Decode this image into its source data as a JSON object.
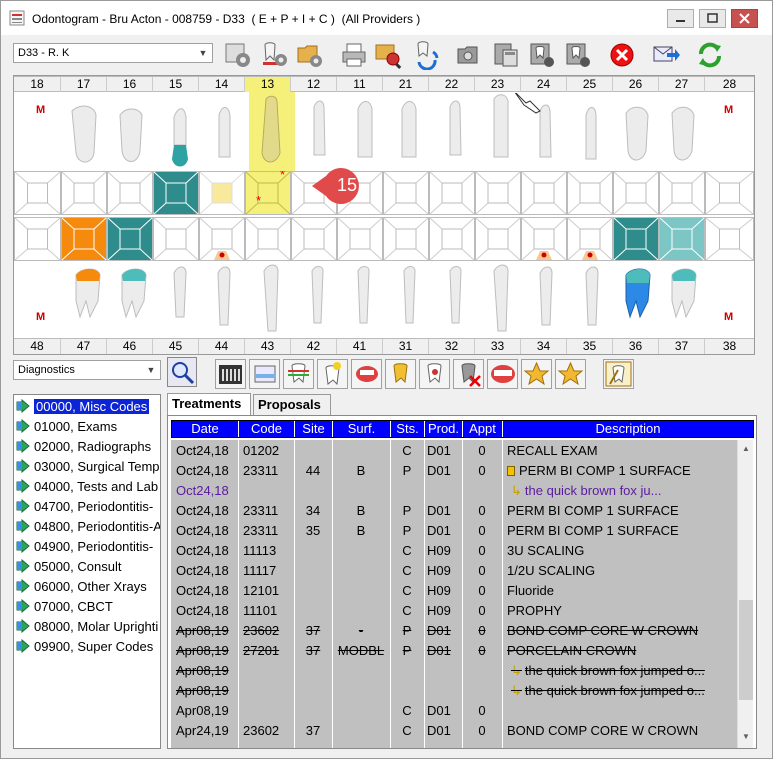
{
  "window": {
    "title": "Odontogram - Bru Acton - 008759 - D33  ( E + P + I + C )  (All Providers )"
  },
  "toolbar": {
    "provider_combo": "D33 - R. K",
    "icons": [
      "settings-icon",
      "tooth-settings-icon",
      "folder-settings-icon",
      "print-icon",
      "search-plan-icon",
      "refresh-tooth-icon",
      "camera-icon",
      "calculator-icon",
      "tooth-info-icon",
      "tooth-check-icon",
      "cancel-icon",
      "send-icon",
      "sync-icon"
    ]
  },
  "chart": {
    "upper_numbers": [
      "18",
      "17",
      "16",
      "15",
      "14",
      "13",
      "12",
      "11",
      "21",
      "22",
      "23",
      "24",
      "25",
      "26",
      "27",
      "28"
    ],
    "lower_numbers": [
      "48",
      "47",
      "46",
      "45",
      "44",
      "43",
      "42",
      "41",
      "31",
      "32",
      "33",
      "34",
      "35",
      "36",
      "37",
      "38"
    ],
    "missing_marks": [
      "M",
      "M",
      "M",
      "M"
    ],
    "callout_value": "15",
    "colors": {
      "teal": "#2e8c8c",
      "light_teal": "#7cc6c6",
      "orange": "#f58a0c",
      "light_yellow": "#f8e99c",
      "highlight": "#f5f07a",
      "peach": "#f8c890"
    }
  },
  "category_combo": "Diagnostics",
  "tree": [
    {
      "label": "00000, Misc Codes",
      "selected": true
    },
    {
      "label": "01000, Exams"
    },
    {
      "label": "02000, Radiographs"
    },
    {
      "label": "03000, Surgical Temp"
    },
    {
      "label": "04000, Tests and Lab"
    },
    {
      "label": "04700, Periodontitis-"
    },
    {
      "label": "04800, Periodontitis-A"
    },
    {
      "label": "04900, Periodontitis-"
    },
    {
      "label": "05000, Consult"
    },
    {
      "label": "06000, Other Xrays"
    },
    {
      "label": "07000, CBCT"
    },
    {
      "label": "08000, Molar Uprighti"
    },
    {
      "label": "09900, Super Codes"
    }
  ],
  "tabs": [
    "Treatments",
    "Proposals"
  ],
  "columns": [
    "Date",
    "Code",
    "Site",
    "Surf.",
    "Sts.",
    "Prod.",
    "Appt",
    "Description"
  ],
  "rows": [
    {
      "date": "Oct24,18",
      "code": "01202",
      "site": "",
      "surf": "",
      "sts": "C",
      "prod": "D01",
      "appt": "0",
      "desc": "RECALL EXAM",
      "type": "normal"
    },
    {
      "date": "Oct24,18",
      "code": "23311",
      "site": "44",
      "surf": "B",
      "sts": "P",
      "prod": "D01",
      "appt": "0",
      "desc": "PERM BI COMP 1 SURFACE",
      "type": "normal",
      "icon": true
    },
    {
      "date": "Oct24,18",
      "code": "",
      "site": "",
      "surf": "",
      "sts": "",
      "prod": "",
      "appt": "",
      "desc": "the quick brown fox ju...",
      "type": "note"
    },
    {
      "date": "Oct24,18",
      "code": "23311",
      "site": "34",
      "surf": "B",
      "sts": "P",
      "prod": "D01",
      "appt": "0",
      "desc": "PERM BI COMP 1 SURFACE",
      "type": "normal"
    },
    {
      "date": "Oct24,18",
      "code": "23311",
      "site": "35",
      "surf": "B",
      "sts": "P",
      "prod": "D01",
      "appt": "0",
      "desc": "PERM BI COMP 1 SURFACE",
      "type": "normal"
    },
    {
      "date": "Oct24,18",
      "code": "11113",
      "site": "",
      "surf": "",
      "sts": "C",
      "prod": "H09",
      "appt": "0",
      "desc": "3U SCALING",
      "type": "normal"
    },
    {
      "date": "Oct24,18",
      "code": "11117",
      "site": "",
      "surf": "",
      "sts": "C",
      "prod": "H09",
      "appt": "0",
      "desc": "1/2U SCALING",
      "type": "normal"
    },
    {
      "date": "Oct24,18",
      "code": "12101",
      "site": "",
      "surf": "",
      "sts": "C",
      "prod": "H09",
      "appt": "0",
      "desc": "Fluoride",
      "type": "normal"
    },
    {
      "date": "Oct24,18",
      "code": "11101",
      "site": "",
      "surf": "",
      "sts": "C",
      "prod": "H09",
      "appt": "0",
      "desc": "PROPHY",
      "type": "normal"
    },
    {
      "date": "Apr08,19",
      "code": "23602",
      "site": "37",
      "surf": "-",
      "sts": "P",
      "prod": "D01",
      "appt": "0",
      "desc": "BOND COMP CORE W CROWN",
      "type": "strike"
    },
    {
      "date": "Apr08,19",
      "code": "27201",
      "site": "37",
      "surf": "MODBL",
      "sts": "P",
      "prod": "D01",
      "appt": "0",
      "desc": "PORCELAIN CROWN",
      "type": "strike"
    },
    {
      "date": "Apr08,19",
      "code": "",
      "site": "",
      "surf": "",
      "sts": "",
      "prod": "",
      "appt": "",
      "desc": "the quick brown fox jumped o...",
      "type": "strike-note"
    },
    {
      "date": "Apr08,19",
      "code": "",
      "site": "",
      "surf": "",
      "sts": "",
      "prod": "",
      "appt": "",
      "desc": "the quick brown fox jumped o...",
      "type": "strike-note"
    },
    {
      "date": "Apr08,19",
      "code": "",
      "site": "",
      "surf": "",
      "sts": "C",
      "prod": "D01",
      "appt": "0",
      "desc": "",
      "type": "normal"
    },
    {
      "date": "Apr24,19",
      "code": "23602",
      "site": "37",
      "surf": "",
      "sts": "C",
      "prod": "D01",
      "appt": "0",
      "desc": "BOND COMP CORE W CROWN",
      "type": "normal"
    }
  ]
}
